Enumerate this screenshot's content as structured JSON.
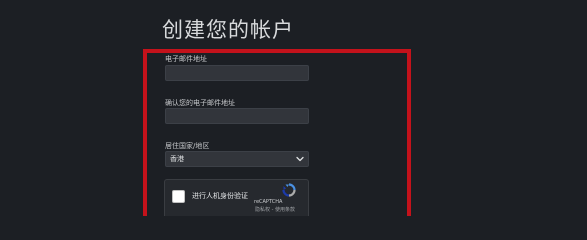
{
  "page": {
    "title": "创建您的帐户"
  },
  "form": {
    "email_label": "电子邮件地址",
    "email_value": "",
    "confirm_email_label": "确认您的电子邮件地址",
    "confirm_email_value": "",
    "country_label": "居住国家/地区",
    "country_selected": "香港"
  },
  "recaptcha": {
    "label": "进行人机身份验证",
    "brand": "reCAPTCHA",
    "privacy_link": "隐私权",
    "separator": " - ",
    "terms_link": "使用条款"
  },
  "colors": {
    "background": "#1c1f24",
    "highlight": "#c4121b",
    "input_background": "#32353b",
    "recaptcha_blue": "#1c3aa9",
    "recaptcha_light_blue": "#4a90e2",
    "recaptcha_gray": "#ababab"
  },
  "icons": {
    "select_chevron": "chevron-down-icon",
    "recaptcha_logo": "recaptcha-logo-icon"
  }
}
